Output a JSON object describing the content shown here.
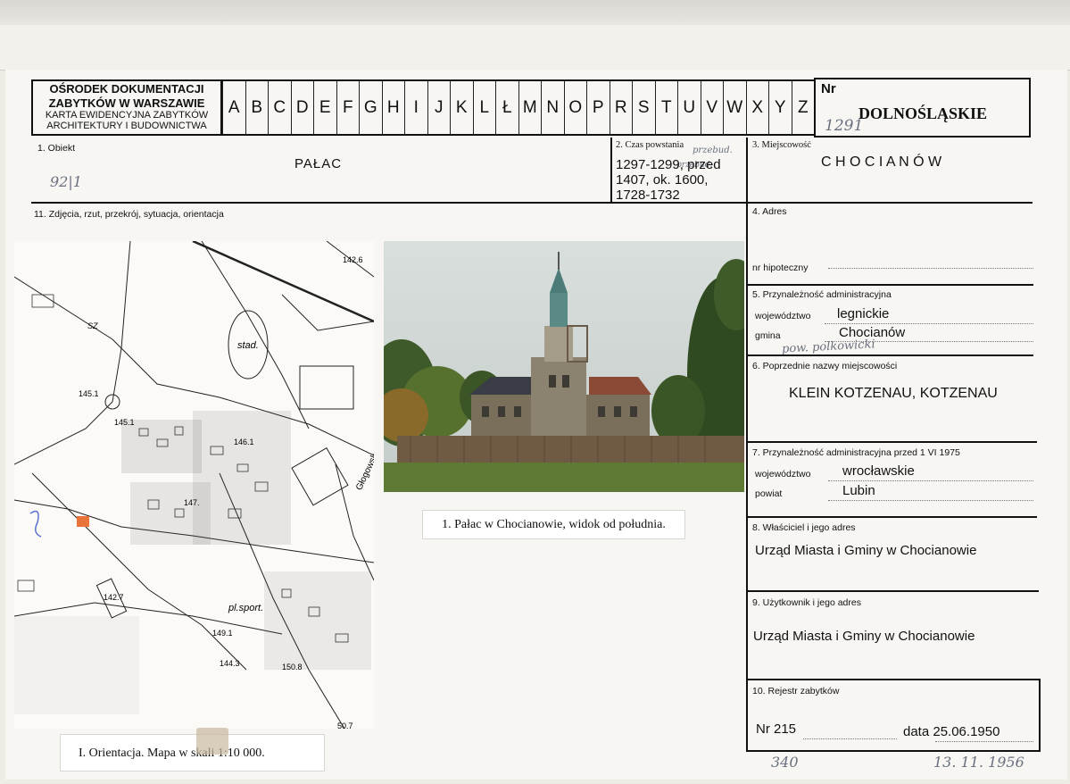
{
  "header": {
    "institution_line1": "OŚRODEK DOKUMENTACJI",
    "institution_line2": "ZABYTKÓW W WARSZAWIE",
    "card_line1": "KARTA EWIDENCYJNA ZABYTKÓW",
    "card_line2": "ARCHITEKTURY I BUDOWNICTWA",
    "letters": [
      "A",
      "B",
      "C",
      "D",
      "E",
      "F",
      "G",
      "H",
      "I",
      "J",
      "K",
      "L",
      "Ł",
      "M",
      "N",
      "O",
      "P",
      "R",
      "S",
      "T",
      "U",
      "V",
      "W",
      "X",
      "Y",
      "Z"
    ],
    "nr_label": "Nr",
    "nr_handwritten": "1291",
    "region": "DOLNOŚLĄSKIE"
  },
  "fields": {
    "obiekt_label": "1. Obiekt",
    "obiekt_value": "PAŁAC",
    "obiekt_hand": "92|1",
    "czas_label": "2. Czas powstania",
    "czas_value": "1297-1299, przed 1407, ok. 1600, 1728-1732",
    "czas_hand1": "przebud.",
    "czas_hand2": "przebud.",
    "miejscowosc_label": "3. Miejscowość",
    "miejscowosc_value": "C H O C I A N Ó W",
    "zdjecia_label": "11. Zdjęcia, rzut, przekrój, sytuacja, orientacja",
    "adres_label": "4. Adres",
    "hipoteczny_label": "nr hipoteczny",
    "przynaleznosc_label": "5. Przynależność administracyjna",
    "wojewodztwo_label": "województwo",
    "wojewodztwo_value": "legnickie",
    "gmina_label": "gmina",
    "gmina_value": "Chocianów",
    "pow_hand": "pow. polkowicki",
    "poprzednie_label": "6. Poprzednie nazwy miejscowości",
    "poprzednie_value": "KLEIN KOTZENAU, KOTZENAU",
    "przed1975_label": "7. Przynależność administracyjna przed 1 VI 1975",
    "woj1975_label": "województwo",
    "woj1975_value": "wrocławskie",
    "powiat_label": "powiat",
    "powiat_value": "Lubin",
    "wlasciciel_label": "8. Właściciel i jego adres",
    "wlasciciel_value": "Urząd Miasta i Gminy w Chocianowie",
    "uzytkownik_label": "9.  Użytkownik i jego adres",
    "uzytkownik_value": "Urząd Miasta i Gminy w Chocianowie",
    "rejestr_label": "10. Rejestr zabytków",
    "rejestr_nr": "Nr 215",
    "rejestr_data": "data 25.06.1950",
    "hand_bottom_left": "340",
    "hand_bottom_right": "13. 11. 1956"
  },
  "captions": {
    "photo": "1. Pałac w Chocianowie, widok od południa.",
    "map": "I. Orientacja. Mapa w skali 1:10 000."
  },
  "map_labels": {
    "stad": "stad.",
    "sport": "pl.sport.",
    "street": "Głogowska",
    "e1": "142.6",
    "e2": "145.1",
    "e3": "145.1",
    "e4": "146.1",
    "e5": "147.",
    "e6": "142.7",
    "e7": "149.1",
    "e8": "144.3",
    "e9": "150.8",
    "e10": "50.7",
    "sz": "SZ"
  },
  "colors": {
    "rule": "#111111",
    "marker": "#e8743a",
    "pencil": "#6a6f80"
  }
}
